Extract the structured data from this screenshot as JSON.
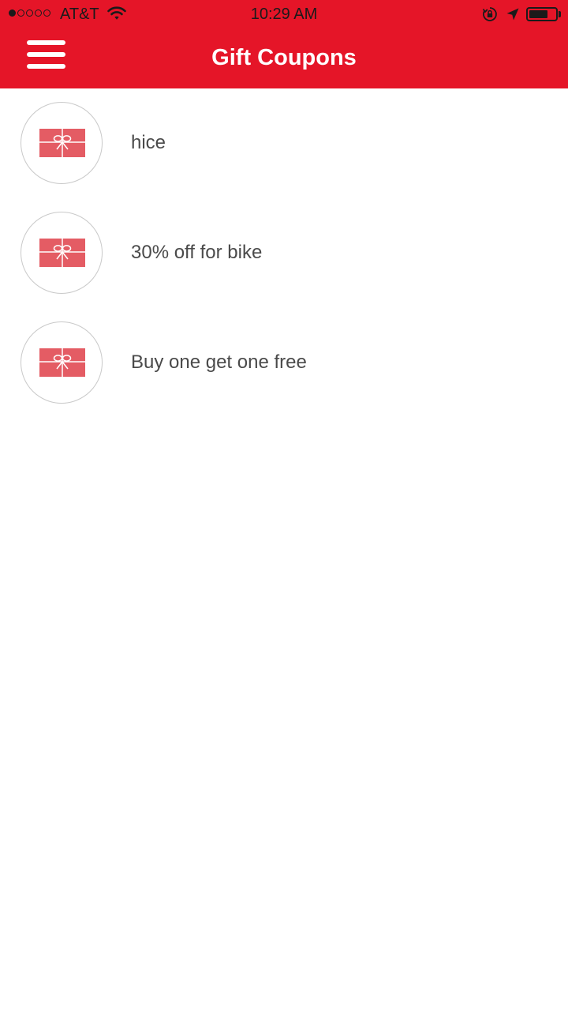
{
  "status_bar": {
    "carrier": "AT&T",
    "time": "10:29 AM",
    "signal_bars": 1,
    "signal_total": 5,
    "battery_level": 0.72
  },
  "header": {
    "title": "Gift Coupons",
    "background_color": "#e51528",
    "menu_icon": "hamburger-menu-icon"
  },
  "coupons": [
    {
      "name": "hice",
      "icon": "gift-card-icon"
    },
    {
      "name": "30% off for bike",
      "icon": "gift-card-icon"
    },
    {
      "name": "Buy one get one free",
      "icon": "gift-card-icon"
    }
  ],
  "colors": {
    "accent": "#e51528",
    "gift_card": "#e45c64",
    "label_text": "#4a4a4a"
  }
}
